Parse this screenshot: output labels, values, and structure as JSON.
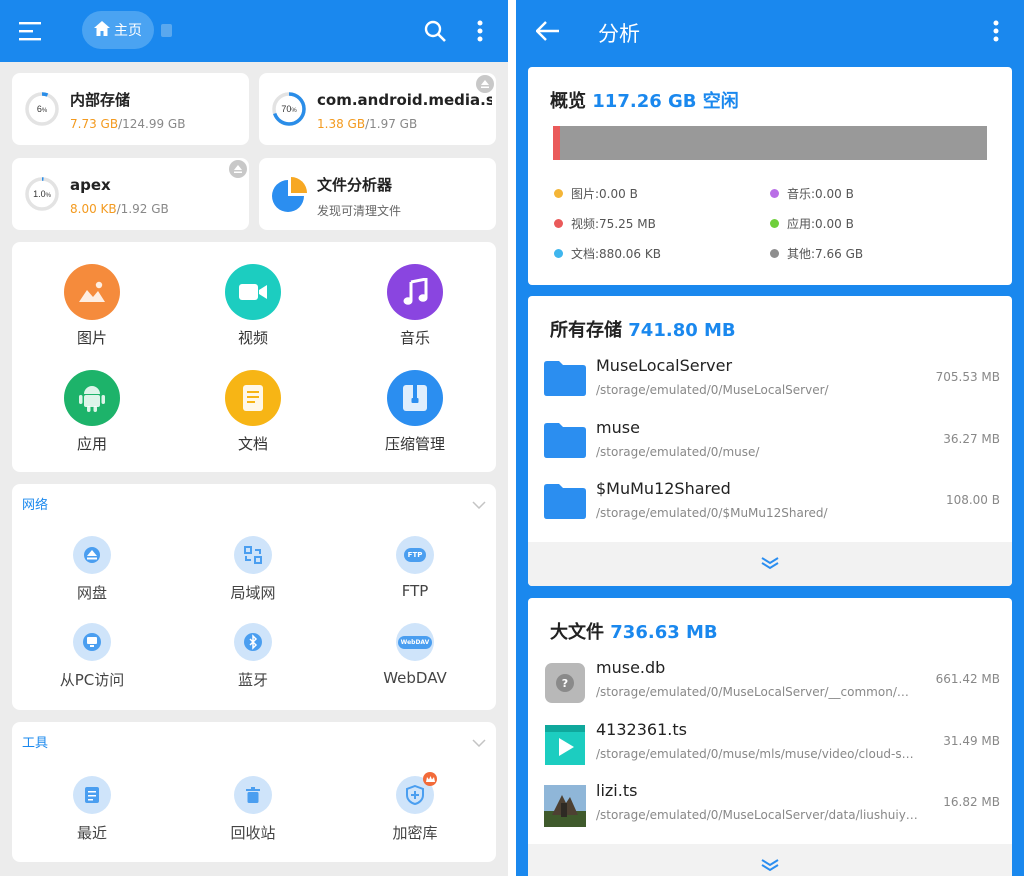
{
  "left": {
    "header": {
      "home_label": "主页"
    },
    "storage": [
      {
        "name": "内部存储",
        "used": "7.73 GB",
        "total": "/124.99 GB",
        "percent": "6",
        "percent_unit": "%",
        "fraction": 0.06
      },
      {
        "name": "com.android.media.sw…",
        "used": "1.38 GB",
        "total": "/1.97 GB",
        "percent": "70",
        "percent_unit": "%",
        "fraction": 0.7
      },
      {
        "name": "apex",
        "used": "8.00 KB",
        "total": "/1.92 GB",
        "percent": "1.0",
        "percent_unit": "%",
        "fraction": 0.01
      },
      {
        "name": "文件分析器",
        "subtitle": "发现可清理文件"
      }
    ],
    "categories": [
      {
        "label": "图片",
        "icon": "image-icon",
        "color": "#f58b3c"
      },
      {
        "label": "视频",
        "icon": "video-icon",
        "color": "#1ccdc0"
      },
      {
        "label": "音乐",
        "icon": "music-icon",
        "color": "#8a45e0"
      },
      {
        "label": "应用",
        "icon": "android-icon",
        "color": "#1db36a"
      },
      {
        "label": "文档",
        "icon": "document-icon",
        "color": "#f7b515"
      },
      {
        "label": "压缩管理",
        "icon": "archive-icon",
        "color": "#2b8ef0"
      }
    ],
    "network": {
      "title": "网络",
      "items": [
        {
          "label": "网盘",
          "icon": "cloud-drive-icon"
        },
        {
          "label": "局域网",
          "icon": "lan-icon"
        },
        {
          "label": "FTP",
          "icon": "ftp-icon",
          "badge": "FTP"
        },
        {
          "label": "从PC访问",
          "icon": "pc-access-icon"
        },
        {
          "label": "蓝牙",
          "icon": "bluetooth-icon"
        },
        {
          "label": "WebDAV",
          "icon": "webdav-icon",
          "badge": "WebDAV"
        }
      ]
    },
    "tools": {
      "title": "工具",
      "items": [
        {
          "label": "最近",
          "icon": "recent-icon"
        },
        {
          "label": "回收站",
          "icon": "recycle-bin-icon"
        },
        {
          "label": "加密库",
          "icon": "vault-icon"
        }
      ]
    }
  },
  "right": {
    "header": {
      "title": "分析"
    },
    "overview": {
      "label": "概览",
      "free": "117.26 GB 空闲",
      "legend": [
        {
          "label": "图片:0.00 B",
          "color": "#f4b537"
        },
        {
          "label": "音乐:0.00 B",
          "color": "#b96ee6"
        },
        {
          "label": "视频:75.25 MB",
          "color": "#ea5a5a"
        },
        {
          "label": "应用:0.00 B",
          "color": "#6fcf3b"
        },
        {
          "label": "文档:880.06 KB",
          "color": "#3fb6ee"
        },
        {
          "label": "其他:7.66 GB",
          "color": "#8e8e8e"
        }
      ]
    },
    "all_storage": {
      "label": "所有存储",
      "total": "741.80 MB",
      "items": [
        {
          "name": "MuseLocalServer",
          "path": "/storage/emulated/0/MuseLocalServer/",
          "size": "705.53 MB"
        },
        {
          "name": "muse",
          "path": "/storage/emulated/0/muse/",
          "size": "36.27 MB"
        },
        {
          "name": "$MuMu12Shared",
          "path": "/storage/emulated/0/$MuMu12Shared/",
          "size": "108.00 B"
        }
      ]
    },
    "large_files": {
      "label": "大文件",
      "total": "736.63 MB",
      "items": [
        {
          "name": "muse.db",
          "path": "/storage/emulated/0/MuseLocalServer/__common/…",
          "size": "661.42 MB",
          "icon": "unknown-file-icon"
        },
        {
          "name": "4132361.ts",
          "path": "/storage/emulated/0/muse/mls/muse/video/cloud-s…",
          "size": "31.49 MB",
          "icon": "video-file-icon"
        },
        {
          "name": "lizi.ts",
          "path": "/storage/emulated/0/MuseLocalServer/data/liushuiy…",
          "size": "16.82 MB",
          "icon": "image-thumbnail-icon"
        }
      ]
    }
  },
  "colors": {
    "accent": "#1a88ee",
    "highlight": "#f39a1f"
  }
}
